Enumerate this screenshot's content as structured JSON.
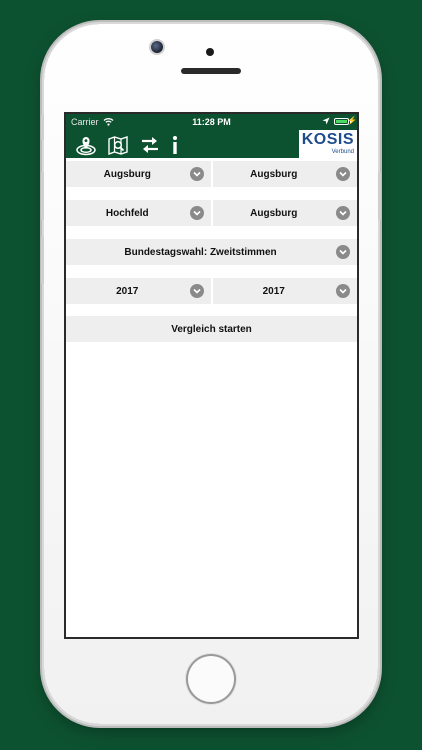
{
  "status_bar": {
    "carrier": "Carrier",
    "time": "11:28 PM"
  },
  "toolbar": {
    "icons": [
      "location-target-icon",
      "map-search-icon",
      "swap-arrows-icon",
      "info-icon"
    ],
    "logo": {
      "main": "KOSIS",
      "sub": "Verbund"
    }
  },
  "selectors": {
    "region_left": "Augsburg",
    "region_right": "Augsburg",
    "district_left": "Hochfeld",
    "district_right": "Augsburg",
    "election": "Bundestagswahl: Zweitstimmen",
    "year_left": "2017",
    "year_right": "2017"
  },
  "actions": {
    "compare_label": "Vergleich starten"
  },
  "colors": {
    "background": "#0d5230",
    "appbar": "#0d5230",
    "logo_text": "#1f4c8c",
    "dropdown_bg": "#eeeeee",
    "chevron": "#8a8a8a"
  }
}
